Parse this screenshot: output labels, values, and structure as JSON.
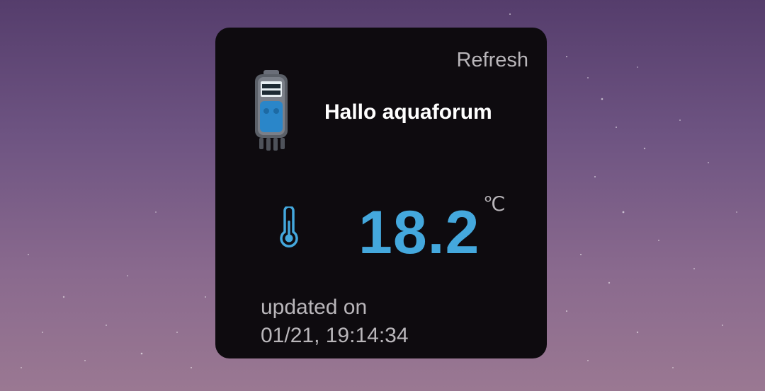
{
  "widget": {
    "refresh_label": "Refresh",
    "greeting": "Hallo aquaforum",
    "temperature": "18.2",
    "unit": "℃",
    "updated_label": "updated on",
    "updated_time": "01/21, 19:14:34",
    "device_icon": "aquarium-controller-icon",
    "thermometer_icon": "thermometer-icon"
  },
  "colors": {
    "widget_bg": "#0e0b0f",
    "accent": "#44a8dd",
    "muted_text": "#b9b6ba",
    "primary_text": "#ffffff"
  }
}
